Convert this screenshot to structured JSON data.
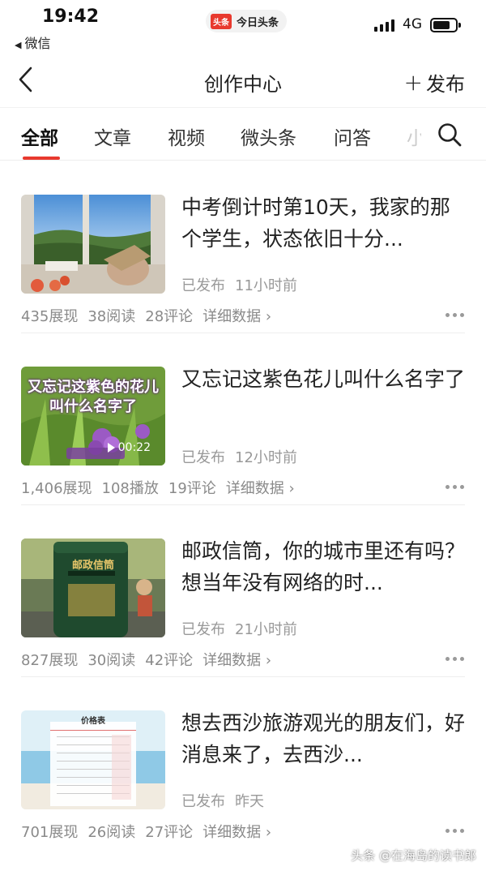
{
  "status_bar": {
    "time": "19:42",
    "back_app": "微信",
    "app_badge_logo": "头条",
    "app_badge_name": "今日头条",
    "network": "4G",
    "signal_icon": "cellular-signal-icon",
    "battery_icon": "battery-icon",
    "battery_level": 0.75
  },
  "nav": {
    "title": "创作中心",
    "publish_label": "发布",
    "back_icon": "chevron-left-icon",
    "publish_icon": "plus-icon"
  },
  "tabs": {
    "items": [
      "全部",
      "文章",
      "视频",
      "微头条",
      "问答",
      "小"
    ],
    "active_index": 0,
    "search_icon": "search-icon"
  },
  "articles": [
    {
      "title": "中考倒计时第10天，我家的那个学生，状态依旧十分...",
      "status": "已发布",
      "time": "11小时前",
      "impressions": "435展现",
      "views": "38阅读",
      "comments": "28评论",
      "detail": "详细数据 ›"
    },
    {
      "title": "又忘记这紫色花儿叫什么名字了",
      "status": "已发布",
      "time": "12小时前",
      "impressions": "1,406展现",
      "views": "108播放",
      "comments": "19评论",
      "detail": "详细数据 ›",
      "thumb_caption": "又忘记这紫色的花儿叫什么名字了",
      "duration": "00:22"
    },
    {
      "title": "邮政信筒，你的城市里还有吗？想当年没有网络的时...",
      "status": "已发布",
      "time": "21小时前",
      "impressions": "827展现",
      "views": "30阅读",
      "comments": "42评论",
      "detail": "详细数据 ›",
      "thumb_caption": "邮政信筒"
    },
    {
      "title": "想去西沙旅游观光的朋友们，好消息来了，去西沙...",
      "status": "已发布",
      "time": "昨天",
      "impressions": "701展现",
      "views": "26阅读",
      "comments": "27评论",
      "detail": "详细数据 ›",
      "thumb_caption": "价格表"
    }
  ],
  "watermark": "头条 @在海岛的读书郎",
  "colors": {
    "accent": "#e8392e",
    "text": "#222222",
    "meta": "#999999"
  }
}
